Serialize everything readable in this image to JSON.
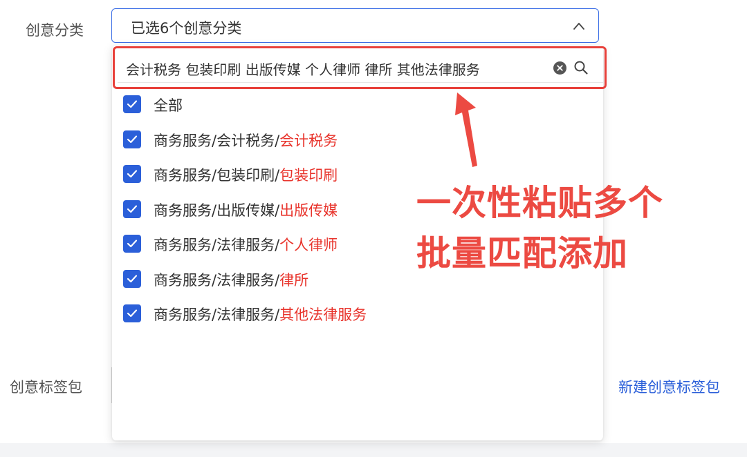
{
  "form": {
    "category_label": "创意分类",
    "tagpack_label": "创意标签包",
    "new_tagpack_link": "新建创意标签包"
  },
  "category_select": {
    "value": "已选6个创意分类",
    "expanded": true,
    "icon": "chevron-up-icon"
  },
  "search": {
    "value": "会计税务 包装印刷 出版传媒 个人律师 律所 其他法律服务",
    "clear_icon": "clear-icon",
    "search_icon": "search-icon"
  },
  "options": [
    {
      "prefix": "全部",
      "match": "",
      "checked": true
    },
    {
      "prefix": "商务服务/会计税务/",
      "match": "会计税务",
      "checked": true
    },
    {
      "prefix": "商务服务/包装印刷/",
      "match": "包装印刷",
      "checked": true
    },
    {
      "prefix": "商务服务/出版传媒/",
      "match": "出版传媒",
      "checked": true
    },
    {
      "prefix": "商务服务/法律服务/",
      "match": "个人律师",
      "checked": true
    },
    {
      "prefix": "商务服务/法律服务/",
      "match": "律所",
      "checked": true
    },
    {
      "prefix": "商务服务/法律服务/",
      "match": "其他法律服务",
      "checked": true
    }
  ],
  "annotation": {
    "line1": "一次性粘贴多个",
    "line2": "批量匹配添加"
  },
  "colors": {
    "accent_blue": "#2b5fd9",
    "match_red": "#e8332b",
    "annotation_red": "#ec4a42"
  }
}
